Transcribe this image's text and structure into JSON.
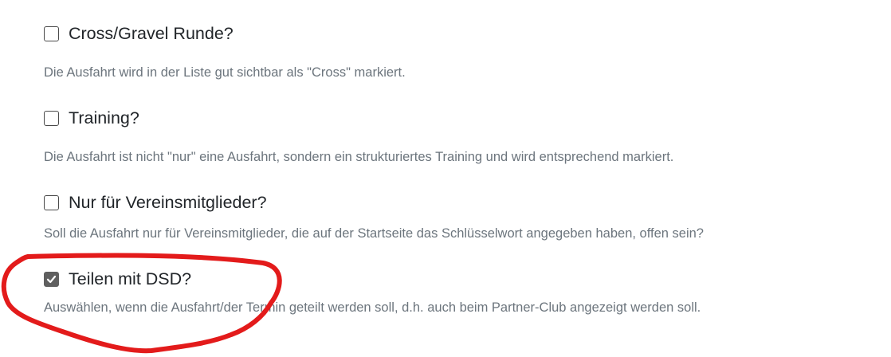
{
  "options": [
    {
      "label": "Cross/Gravel Runde?",
      "checked": false,
      "help": "Die Ausfahrt wird in der Liste gut sichtbar als \"Cross\" markiert."
    },
    {
      "label": "Training?",
      "checked": false,
      "help": "Die Ausfahrt ist nicht \"nur\" eine Ausfahrt, sondern ein strukturiertes Training und wird entsprechend markiert."
    },
    {
      "label": "Nur für Vereinsmitglieder?",
      "checked": false,
      "help": "Soll die Ausfahrt nur für Vereinsmitglieder, die auf der Startseite das Schlüsselwort angegeben haben, offen sein?"
    },
    {
      "label": "Teilen mit DSD?",
      "checked": true,
      "help": "Auswählen, wenn die Ausfahrt/der Termin geteilt werden soll, d.h. auch beim Partner-Club angezeigt werden soll."
    }
  ],
  "colors": {
    "annotation": "#e31b1b",
    "checkbox_checked": "#5f5f5f",
    "help_text": "#6c757d"
  },
  "icons": {
    "checked_mark": "checkmark-icon"
  }
}
